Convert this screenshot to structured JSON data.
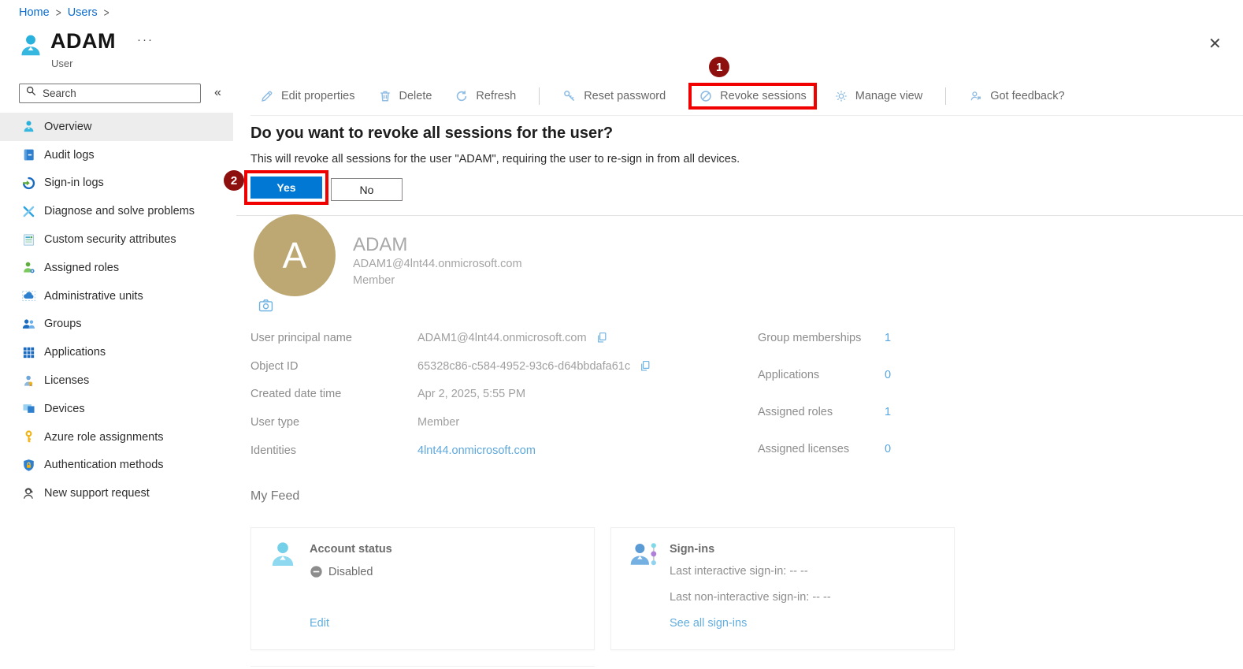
{
  "breadcrumb": {
    "home": "Home",
    "users": "Users"
  },
  "header": {
    "title": "ADAM",
    "subtitle": "User",
    "more": "···",
    "close": "✕"
  },
  "sidebar": {
    "search_placeholder": "Search",
    "collapse": "«",
    "items": [
      {
        "label": "Overview"
      },
      {
        "label": "Audit logs"
      },
      {
        "label": "Sign-in logs"
      },
      {
        "label": "Diagnose and solve problems"
      },
      {
        "label": "Custom security attributes"
      },
      {
        "label": "Assigned roles"
      },
      {
        "label": "Administrative units"
      },
      {
        "label": "Groups"
      },
      {
        "label": "Applications"
      },
      {
        "label": "Licenses"
      },
      {
        "label": "Devices"
      },
      {
        "label": "Azure role assignments"
      },
      {
        "label": "Authentication methods"
      },
      {
        "label": "New support request"
      }
    ]
  },
  "toolbar": {
    "items": [
      {
        "label": "Edit properties"
      },
      {
        "label": "Delete"
      },
      {
        "label": "Refresh"
      },
      {
        "label": "Reset password"
      },
      {
        "label": "Revoke sessions"
      },
      {
        "label": "Manage view"
      },
      {
        "label": "Got feedback?"
      }
    ]
  },
  "annotations": {
    "step1": "1",
    "step2": "2"
  },
  "dialog": {
    "title": "Do you want to revoke all sessions for the user?",
    "body": "This will revoke all sessions for the user \"ADAM\", requiring the user to re-sign in from all devices.",
    "yes_label": "Yes",
    "no_label": "No"
  },
  "profile": {
    "initial": "A",
    "name": "ADAM",
    "upn": "ADAM1@4lnt44.onmicrosoft.com",
    "membership": "Member"
  },
  "properties": {
    "rows": [
      {
        "label": "User principal name",
        "value": "ADAM1@4lnt44.onmicrosoft.com"
      },
      {
        "label": "Object ID",
        "value": "65328c86-c584-4952-93c6-d64bbdafa61c"
      },
      {
        "label": "Created date time",
        "value": "Apr 2, 2025, 5:55 PM"
      },
      {
        "label": "User type",
        "value": "Member"
      },
      {
        "label": "Identities",
        "value": "4lnt44.onmicrosoft.com"
      }
    ]
  },
  "stats": {
    "rows": [
      {
        "label": "Group memberships",
        "value": "1"
      },
      {
        "label": "Applications",
        "value": "0"
      },
      {
        "label": "Assigned roles",
        "value": "1"
      },
      {
        "label": "Assigned licenses",
        "value": "0"
      }
    ]
  },
  "feed": {
    "heading": "My Feed",
    "account_status": {
      "title": "Account status",
      "status": "Disabled",
      "action": "Edit"
    },
    "sign_ins": {
      "title": "Sign-ins",
      "line1": "Last interactive sign-in: -- --",
      "line2": "Last non-interactive sign-in: -- --",
      "action": "See all sign-ins"
    }
  },
  "colors": {
    "accent_blue": "#0078d4",
    "annotation_red": "#f10000",
    "badge_maroon": "#8d100f",
    "avatar_tan": "#bda873",
    "link_blue": "#5ea8dc"
  }
}
